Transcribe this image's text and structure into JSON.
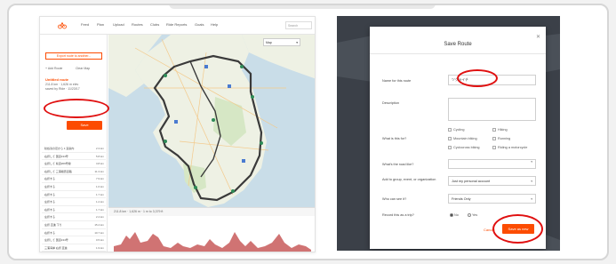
{
  "left": {
    "nav": [
      "Feed",
      "Plan",
      "Upload",
      "Routes",
      "Clubs",
      "Ride Reports",
      "Goals",
      "Help"
    ],
    "search_placeholder": "Search",
    "export_label": "Export route to another...",
    "add_route": "+ Add Route",
    "clear_map": "Clear Map",
    "route_name": "Untitled route",
    "route_stats": "211.8 km · 1,626 m elev",
    "route_sub": "saved by Ride · 11/23/17",
    "save_label": "Save",
    "cues": [
      {
        "t": "秋谷浜の足から 1 道案内",
        "d": "2.3 km"
      },
      {
        "t": "右折して 国道134号",
        "d": "5.8 km"
      },
      {
        "t": "左折して 県道209号線",
        "d": "3.8 km"
      },
      {
        "t": "右折して 三浦縦貫道路",
        "d": "11.3 km"
      },
      {
        "t": "右折する",
        "d": "7.9 km"
      },
      {
        "t": "左折する",
        "d": "1.6 km"
      },
      {
        "t": "右折する",
        "d": "1.7 km"
      },
      {
        "t": "左折する",
        "d": "1.2 km"
      },
      {
        "t": "右折する",
        "d": "1.7 km"
      },
      {
        "t": "左折する",
        "d": "2.4 km"
      },
      {
        "t": "左折 直進 下り",
        "d": "15.4 km"
      },
      {
        "t": "右折する",
        "d": "10.7 km"
      },
      {
        "t": "左折して 国道134号",
        "d": "0.5 km"
      },
      {
        "t": "三浦海岸 右折 直進",
        "d": "1.9 km"
      },
      {
        "t": "右折する",
        "d": "4.0 km"
      }
    ],
    "map_mode": "Map",
    "elev_label": "211.8 km · 1,626 m · 1 m to 3,379 ft",
    "colors": {
      "accent": "#fc4c02",
      "route": "#3a3a3a",
      "elev": "#b03030",
      "annotation": "#e01010"
    }
  },
  "right": {
    "title": "Save Route",
    "name_label": "Name for this route",
    "name_value": "ツクライチ",
    "desc_label": "Description",
    "what_label": "What is this for?",
    "options": [
      "Cycling",
      "Hiking",
      "Mountain biking",
      "Running",
      "Cyclocross biking",
      "Riding a motorcycle"
    ],
    "road_label": "What's the road like?",
    "group_label": "Add to group, event, or organization",
    "group_value": "Just my personal account",
    "who_label": "Who can see it?",
    "who_value": "Friends Only",
    "record_label": "Record this as a trip?",
    "yes": "Yes",
    "no": "No",
    "cancel": "Cancel",
    "save_label": "Save as new"
  }
}
